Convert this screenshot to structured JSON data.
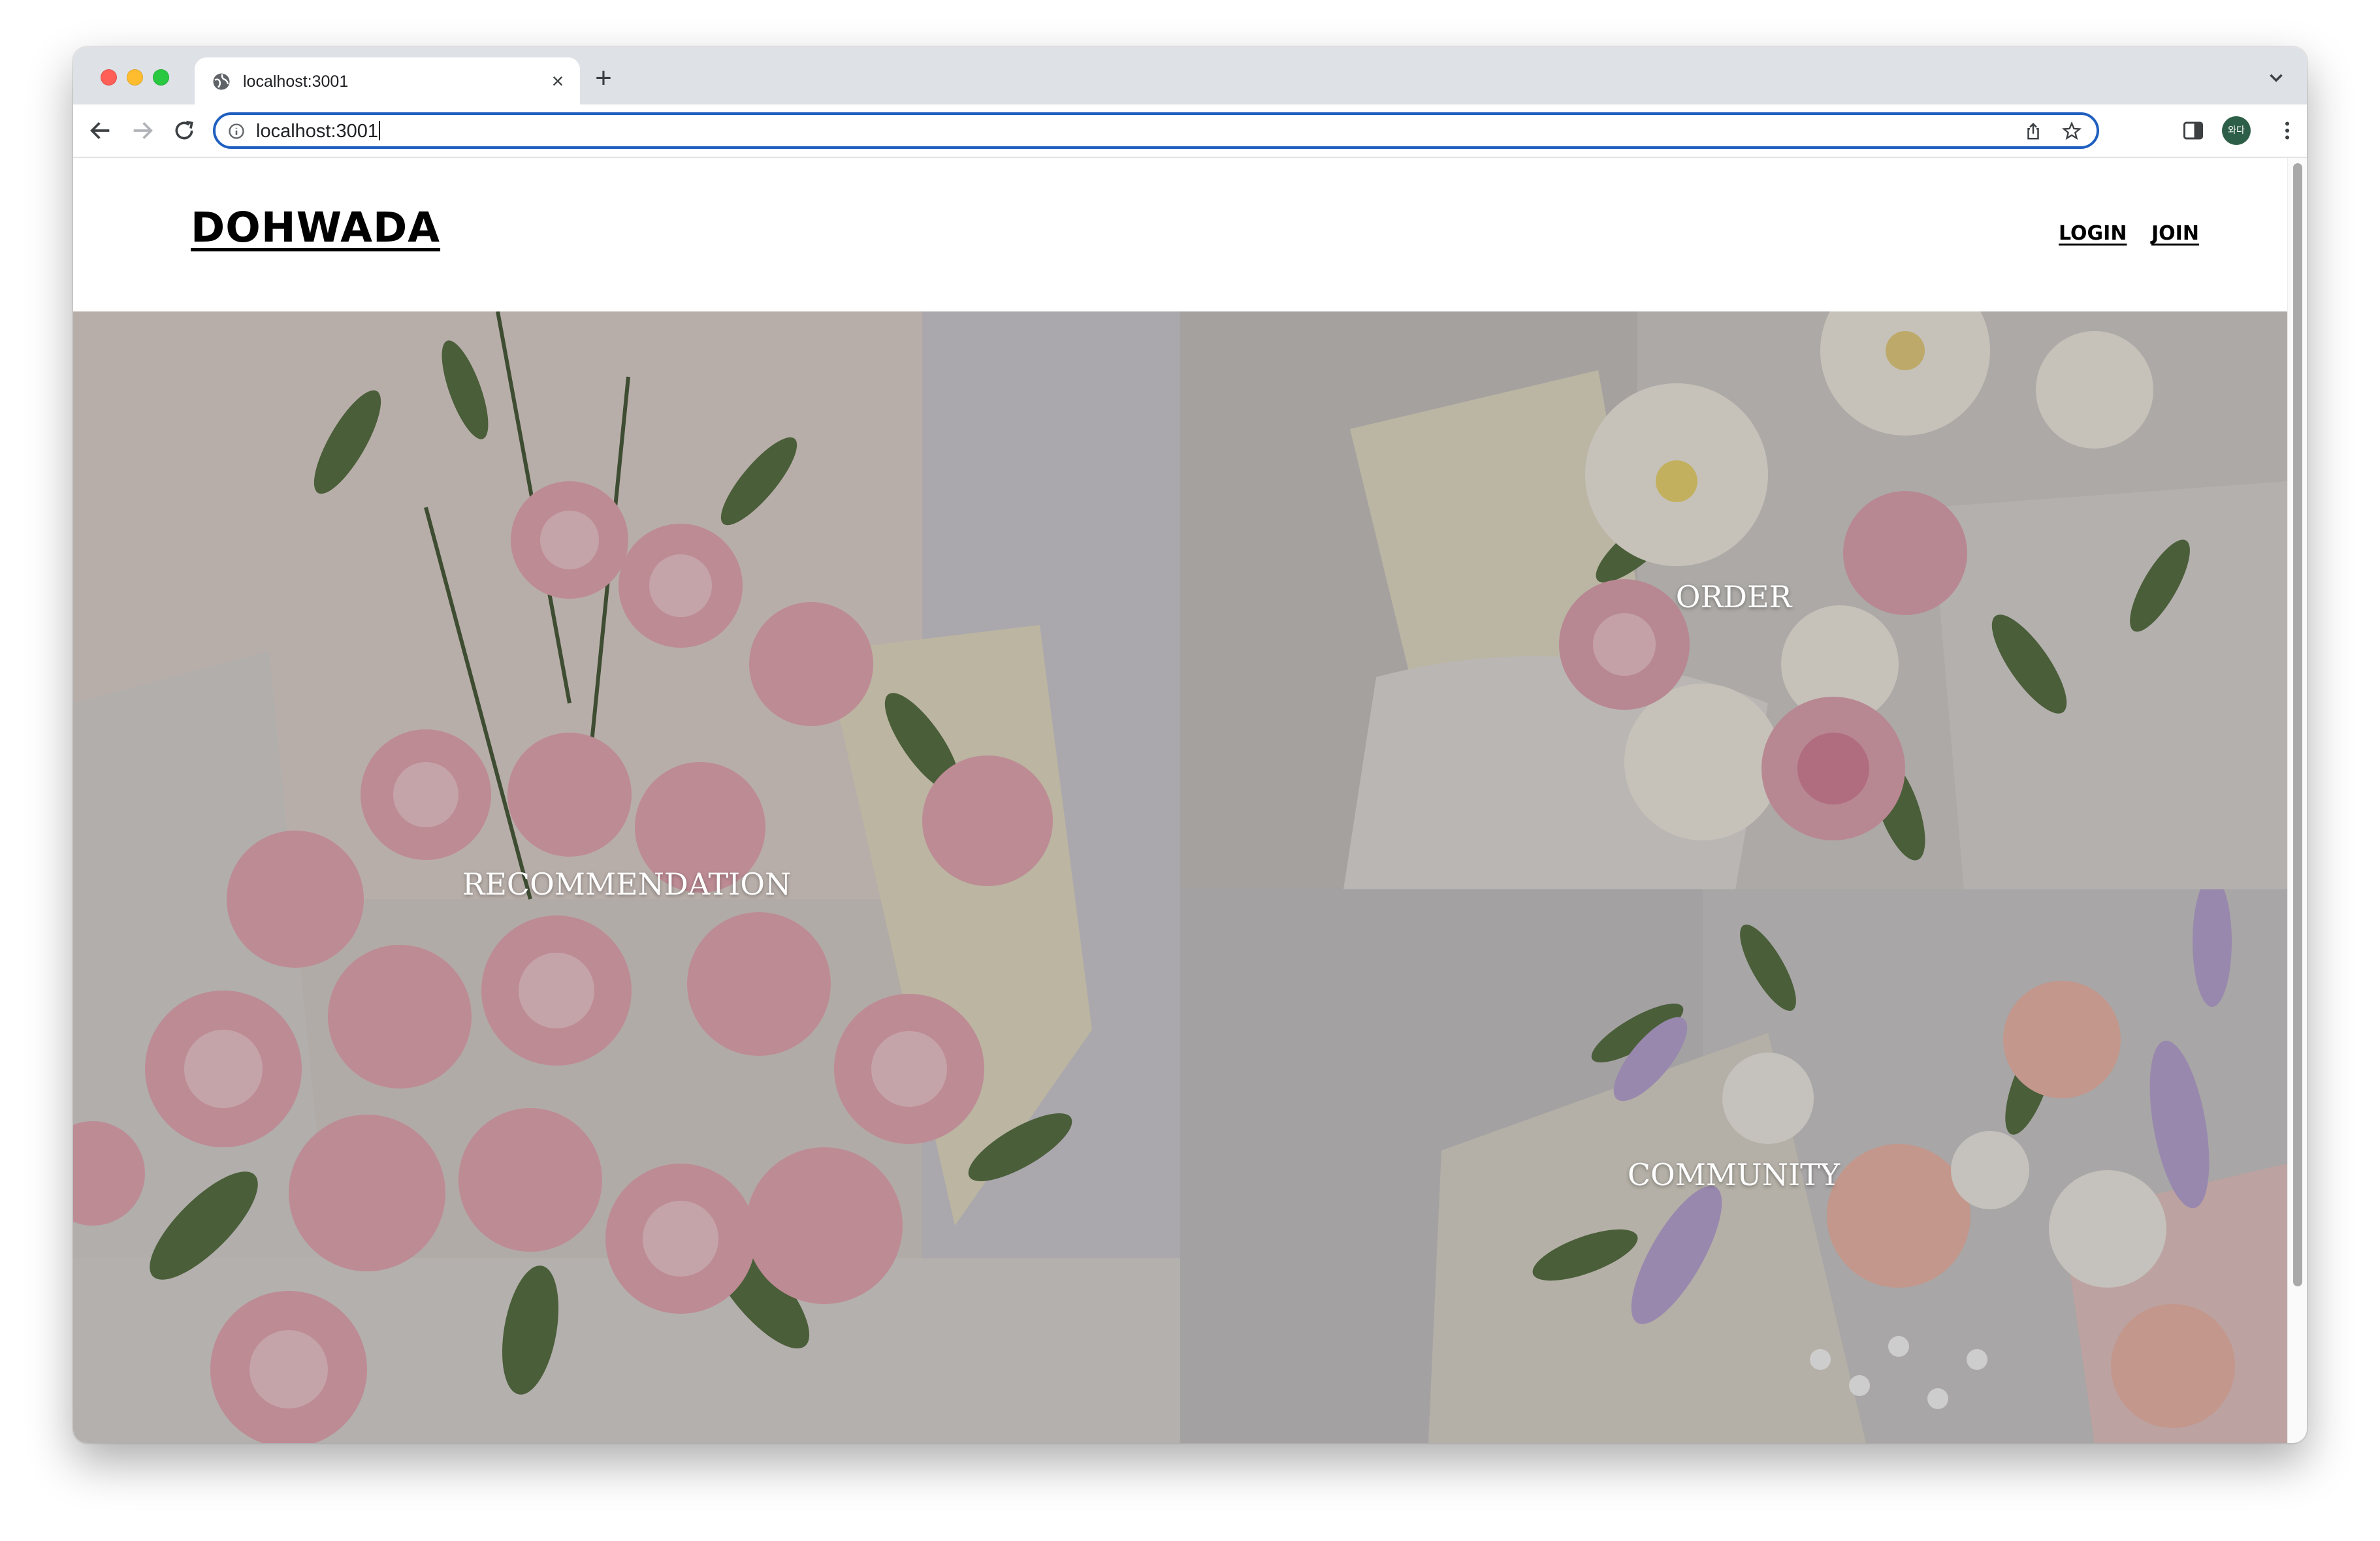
{
  "browser": {
    "tab": {
      "title": "localhost:3001"
    },
    "address_bar": {
      "url": "localhost:3001"
    },
    "profile_initials": "와다"
  },
  "site": {
    "logo": "DOHWADA",
    "nav": {
      "login": "LOGIN",
      "join": "JOIN"
    },
    "tiles": [
      {
        "label": "RECOMMENDATION"
      },
      {
        "label": "ORDER"
      },
      {
        "label": "COMMUNITY"
      }
    ]
  },
  "colors": {
    "address_focus": "#1f5fbf",
    "profile_avatar": "#2d5f48",
    "rose_pink": "#e9a7b3",
    "foliage_green": "#4f6b3a"
  }
}
